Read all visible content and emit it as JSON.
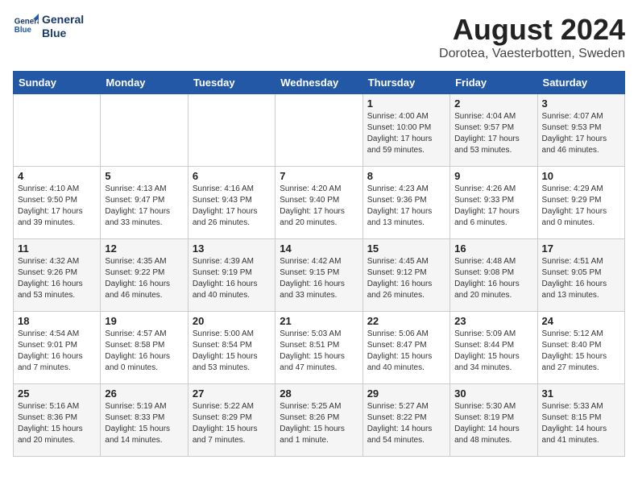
{
  "header": {
    "logo_line1": "General",
    "logo_line2": "Blue",
    "main_title": "August 2024",
    "subtitle": "Dorotea, Vaesterbotten, Sweden"
  },
  "weekdays": [
    "Sunday",
    "Monday",
    "Tuesday",
    "Wednesday",
    "Thursday",
    "Friday",
    "Saturday"
  ],
  "weeks": [
    [
      {
        "day": "",
        "info": ""
      },
      {
        "day": "",
        "info": ""
      },
      {
        "day": "",
        "info": ""
      },
      {
        "day": "",
        "info": ""
      },
      {
        "day": "1",
        "info": "Sunrise: 4:00 AM\nSunset: 10:00 PM\nDaylight: 17 hours\nand 59 minutes."
      },
      {
        "day": "2",
        "info": "Sunrise: 4:04 AM\nSunset: 9:57 PM\nDaylight: 17 hours\nand 53 minutes."
      },
      {
        "day": "3",
        "info": "Sunrise: 4:07 AM\nSunset: 9:53 PM\nDaylight: 17 hours\nand 46 minutes."
      }
    ],
    [
      {
        "day": "4",
        "info": "Sunrise: 4:10 AM\nSunset: 9:50 PM\nDaylight: 17 hours\nand 39 minutes."
      },
      {
        "day": "5",
        "info": "Sunrise: 4:13 AM\nSunset: 9:47 PM\nDaylight: 17 hours\nand 33 minutes."
      },
      {
        "day": "6",
        "info": "Sunrise: 4:16 AM\nSunset: 9:43 PM\nDaylight: 17 hours\nand 26 minutes."
      },
      {
        "day": "7",
        "info": "Sunrise: 4:20 AM\nSunset: 9:40 PM\nDaylight: 17 hours\nand 20 minutes."
      },
      {
        "day": "8",
        "info": "Sunrise: 4:23 AM\nSunset: 9:36 PM\nDaylight: 17 hours\nand 13 minutes."
      },
      {
        "day": "9",
        "info": "Sunrise: 4:26 AM\nSunset: 9:33 PM\nDaylight: 17 hours\nand 6 minutes."
      },
      {
        "day": "10",
        "info": "Sunrise: 4:29 AM\nSunset: 9:29 PM\nDaylight: 17 hours\nand 0 minutes."
      }
    ],
    [
      {
        "day": "11",
        "info": "Sunrise: 4:32 AM\nSunset: 9:26 PM\nDaylight: 16 hours\nand 53 minutes."
      },
      {
        "day": "12",
        "info": "Sunrise: 4:35 AM\nSunset: 9:22 PM\nDaylight: 16 hours\nand 46 minutes."
      },
      {
        "day": "13",
        "info": "Sunrise: 4:39 AM\nSunset: 9:19 PM\nDaylight: 16 hours\nand 40 minutes."
      },
      {
        "day": "14",
        "info": "Sunrise: 4:42 AM\nSunset: 9:15 PM\nDaylight: 16 hours\nand 33 minutes."
      },
      {
        "day": "15",
        "info": "Sunrise: 4:45 AM\nSunset: 9:12 PM\nDaylight: 16 hours\nand 26 minutes."
      },
      {
        "day": "16",
        "info": "Sunrise: 4:48 AM\nSunset: 9:08 PM\nDaylight: 16 hours\nand 20 minutes."
      },
      {
        "day": "17",
        "info": "Sunrise: 4:51 AM\nSunset: 9:05 PM\nDaylight: 16 hours\nand 13 minutes."
      }
    ],
    [
      {
        "day": "18",
        "info": "Sunrise: 4:54 AM\nSunset: 9:01 PM\nDaylight: 16 hours\nand 7 minutes."
      },
      {
        "day": "19",
        "info": "Sunrise: 4:57 AM\nSunset: 8:58 PM\nDaylight: 16 hours\nand 0 minutes."
      },
      {
        "day": "20",
        "info": "Sunrise: 5:00 AM\nSunset: 8:54 PM\nDaylight: 15 hours\nand 53 minutes."
      },
      {
        "day": "21",
        "info": "Sunrise: 5:03 AM\nSunset: 8:51 PM\nDaylight: 15 hours\nand 47 minutes."
      },
      {
        "day": "22",
        "info": "Sunrise: 5:06 AM\nSunset: 8:47 PM\nDaylight: 15 hours\nand 40 minutes."
      },
      {
        "day": "23",
        "info": "Sunrise: 5:09 AM\nSunset: 8:44 PM\nDaylight: 15 hours\nand 34 minutes."
      },
      {
        "day": "24",
        "info": "Sunrise: 5:12 AM\nSunset: 8:40 PM\nDaylight: 15 hours\nand 27 minutes."
      }
    ],
    [
      {
        "day": "25",
        "info": "Sunrise: 5:16 AM\nSunset: 8:36 PM\nDaylight: 15 hours\nand 20 minutes."
      },
      {
        "day": "26",
        "info": "Sunrise: 5:19 AM\nSunset: 8:33 PM\nDaylight: 15 hours\nand 14 minutes."
      },
      {
        "day": "27",
        "info": "Sunrise: 5:22 AM\nSunset: 8:29 PM\nDaylight: 15 hours\nand 7 minutes."
      },
      {
        "day": "28",
        "info": "Sunrise: 5:25 AM\nSunset: 8:26 PM\nDaylight: 15 hours\nand 1 minute."
      },
      {
        "day": "29",
        "info": "Sunrise: 5:27 AM\nSunset: 8:22 PM\nDaylight: 14 hours\nand 54 minutes."
      },
      {
        "day": "30",
        "info": "Sunrise: 5:30 AM\nSunset: 8:19 PM\nDaylight: 14 hours\nand 48 minutes."
      },
      {
        "day": "31",
        "info": "Sunrise: 5:33 AM\nSunset: 8:15 PM\nDaylight: 14 hours\nand 41 minutes."
      }
    ]
  ]
}
